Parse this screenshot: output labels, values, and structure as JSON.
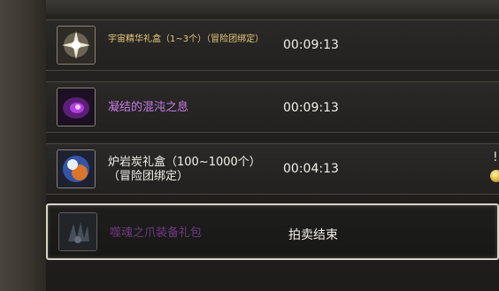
{
  "auction_list": {
    "items": [
      {
        "name": "宇宙精华礼盒（1~3个）（冒险团绑定）",
        "time_left": "00:09:13",
        "icon": "star-burst-box-icon",
        "name_color": "#e8c77a"
      },
      {
        "name": "凝结的混沌之息",
        "time_left": "00:09:13",
        "icon": "purple-chaos-orb-icon",
        "name_color": "#c77be6"
      },
      {
        "name": "炉岩炭礼盒（100~1000个）（冒险团绑定）",
        "time_left": "00:04:13",
        "icon": "lava-orb-box-icon",
        "name_color": "#f2f0ea"
      },
      {
        "name": "噬魂之爪装备礼包",
        "status": "拍卖结束",
        "icon": "dark-claw-icon",
        "name_color": "#7e3f92"
      }
    ]
  }
}
